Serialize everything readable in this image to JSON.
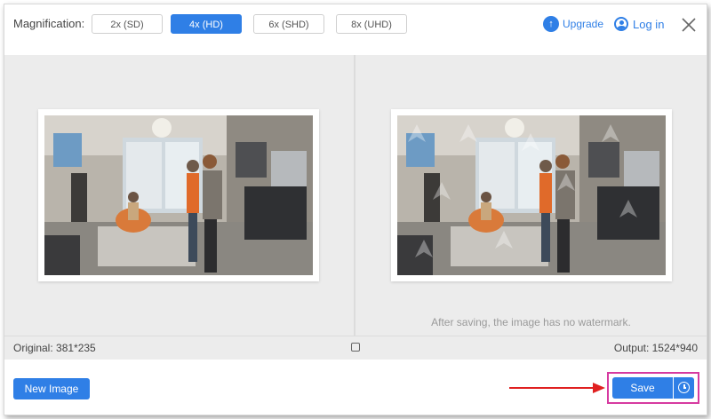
{
  "toolbar": {
    "magnification_label": "Magnification:",
    "options": [
      "2x (SD)",
      "4x (HD)",
      "6x (SHD)",
      "8x (UHD)"
    ],
    "selected": "4x (HD)",
    "upgrade_label": "Upgrade",
    "login_label": "Log in"
  },
  "preview": {
    "watermark_note": "After saving, the image has no watermark."
  },
  "status": {
    "original": "Original: 381*235",
    "output": "Output: 1524*940"
  },
  "bottom": {
    "new_image_label": "New Image",
    "save_label": "Save"
  },
  "colors": {
    "accent": "#2f7fe6",
    "highlight_box": "#d63aa0",
    "arrow": "#e02020"
  }
}
